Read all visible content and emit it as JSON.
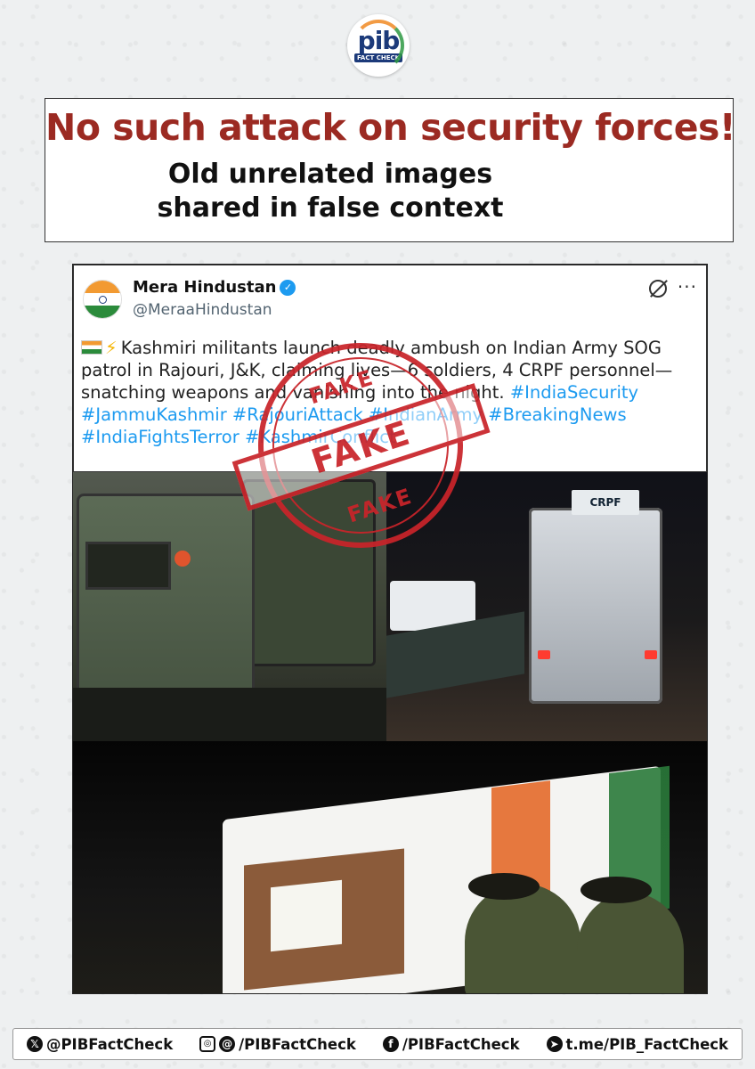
{
  "logo": {
    "main": "pib",
    "sub": "FACT CHECK"
  },
  "headline": {
    "title": "No such attack on security forces!",
    "subtitle": "Old unrelated images shared in false context"
  },
  "post": {
    "display_name": "Mera Hindustan",
    "handle": "@MeraaHindustan",
    "text": "Kashmiri militants launch deadly ambush on Indian Army SOG patrol in Rajouri, J&K, claiming lives—6 soldiers, 4 CRPF personnel—snatching weapons and vanishing into the night.",
    "hashtags": "#IndiaSecurity #JammuKashmir #RajouriAttack #IndianArmy #BreakingNews #IndiaFightsTerror #KashmirConflict"
  },
  "images": {
    "vehicle_label": "CRPF"
  },
  "stamp": {
    "top": "FAKE",
    "band": "FAKE",
    "bottom": "FAKE"
  },
  "footer": {
    "x_handle": "@PIBFactCheck",
    "insta_threads": "/PIBFactCheck",
    "facebook": "/PIBFactCheck",
    "telegram": "t.me/PIB_FactCheck"
  },
  "colors": {
    "headline_red": "#9b2a22",
    "stamp_red": "#c9242a",
    "link_blue": "#1d9bf0"
  }
}
